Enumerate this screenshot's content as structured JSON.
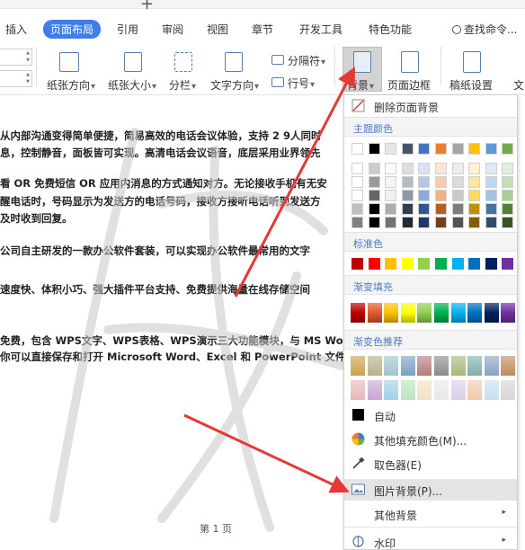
{
  "tabs": [
    "插入",
    "页面布局",
    "引用",
    "审阅",
    "视图",
    "章节",
    "开发工具",
    "特色功能"
  ],
  "active_tab": "页面布局",
  "search_label": "查找命令...",
  "ribbon": {
    "paper_direction": "纸张方向",
    "paper_size": "纸张大小",
    "columns": "分栏",
    "text_direction": "文字方向",
    "separator": "分隔符",
    "line_number": "行号",
    "background": "背景",
    "page_border": "页面边框",
    "manuscript": "稿纸设置",
    "cut_text": "文"
  },
  "document": {
    "lines": [
      "从内部沟通变得简单便捷，简易高效的电话会议体验，支持 2 9人同时",
      "息，控制静音，面板皆可实现。高清电话会议语音，底层采用业界领先",
      "看 OR 免费短信 OR 应用内消息的方式通知对方。无论接收手机有无安",
      "醒电话时，号码显示为发送方的电话号码，接收方接听电话听到发送方",
      "及时收到回复。",
      "公司自主研发的一款办公软件套装，可以实现办公软件最常用的文字",
      "速度快、体积小巧、强大插件平台支持、免费提供海量在线存储空间",
      "免费，包含 WPS文字、WPS表格、WPS演示三大功能模块，与 MS Wor",
      "你可以直接保存和打开 Microsoft Word、Excel 和 PowerPoint 文件"
    ],
    "footer": "第 1 页"
  },
  "menu": {
    "remove_background": "删除页面背景",
    "theme_colors": "主题颜色",
    "standard_colors": "标准色",
    "gradient_fill": "渐变填充",
    "gradient_recommend": "渐变色推荐",
    "auto": "自动",
    "more_fill_colors": "其他填充颜色(M)...",
    "eyedropper": "取色器(E)",
    "picture_background": "图片背景(P)...",
    "other_background": "其他背景",
    "watermark": "水印"
  },
  "colors": {
    "accent": "#3f7de8",
    "link": "#2e63c9",
    "arrow": "#e53935",
    "section_text": "#4a78c2",
    "theme_top": [
      "#ffffff",
      "#000000",
      "#e7e6e6",
      "#44546a",
      "#4472c4",
      "#ed7d31",
      "#a5a5a5",
      "#ffc000",
      "#5b9bd5",
      "#70ad47"
    ],
    "standard": [
      "#c00000",
      "#ff0000",
      "#ffc000",
      "#ffff00",
      "#92d050",
      "#00b050",
      "#00b0f0",
      "#0070c0",
      "#002060",
      "#7030a0"
    ],
    "gradient_fill": [
      "#c00000",
      "#e05a2b",
      "#ffc000",
      "#ffff00",
      "#92d050",
      "#00b050",
      "#00b0f0",
      "#0070c0",
      "#002060",
      "#7030a0"
    ],
    "gradient_rec_1": [
      "#c9a24a",
      "#b5b08a",
      "#9fc3d0",
      "#7a9fc2",
      "#b57a7a",
      "#8a8a8a",
      "#a6b77a",
      "#7fb0a8",
      "#8aa2c4",
      "#c08a5a"
    ],
    "gradient_rec_2": [
      "#e8b7b7",
      "#c9a6d1",
      "#9fd0e8",
      "#bde3bf",
      "#f0e3c4",
      "#e8e8e8",
      "#d9cfe8",
      "#f1c9a8",
      "#c8e0f2",
      "#d6d6d6"
    ]
  }
}
